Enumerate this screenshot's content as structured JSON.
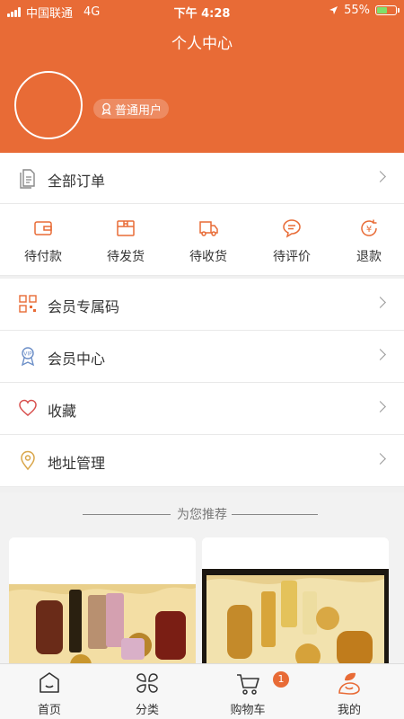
{
  "status_bar": {
    "carrier": "中国联通",
    "network": "4G",
    "time": "下午 4:28",
    "battery": "55%"
  },
  "header": {
    "title": "个人中心",
    "user_badge": "普通用户"
  },
  "orders": {
    "all_label": "全部订单"
  },
  "order_status": [
    {
      "label": "待付款",
      "icon": "wallet-icon"
    },
    {
      "label": "待发货",
      "icon": "package-icon"
    },
    {
      "label": "待收货",
      "icon": "truck-icon"
    },
    {
      "label": "待评价",
      "icon": "comment-icon"
    },
    {
      "label": "退款",
      "icon": "refund-icon"
    }
  ],
  "menu": [
    {
      "label": "会员专属码",
      "icon": "qr-code-icon"
    },
    {
      "label": "会员中心",
      "icon": "vip-medal-icon"
    },
    {
      "label": "收藏",
      "icon": "heart-icon"
    },
    {
      "label": "地址管理",
      "icon": "location-pin-icon"
    }
  ],
  "recommend": {
    "title": "为您推荐"
  },
  "tabbar": [
    {
      "label": "首页",
      "icon": "home-icon"
    },
    {
      "label": "分类",
      "icon": "category-icon"
    },
    {
      "label": "购物车",
      "icon": "cart-icon",
      "badge": "1"
    },
    {
      "label": "我的",
      "icon": "profile-icon"
    }
  ],
  "colors": {
    "accent": "#e86b36",
    "battery": "#7ee06a"
  }
}
